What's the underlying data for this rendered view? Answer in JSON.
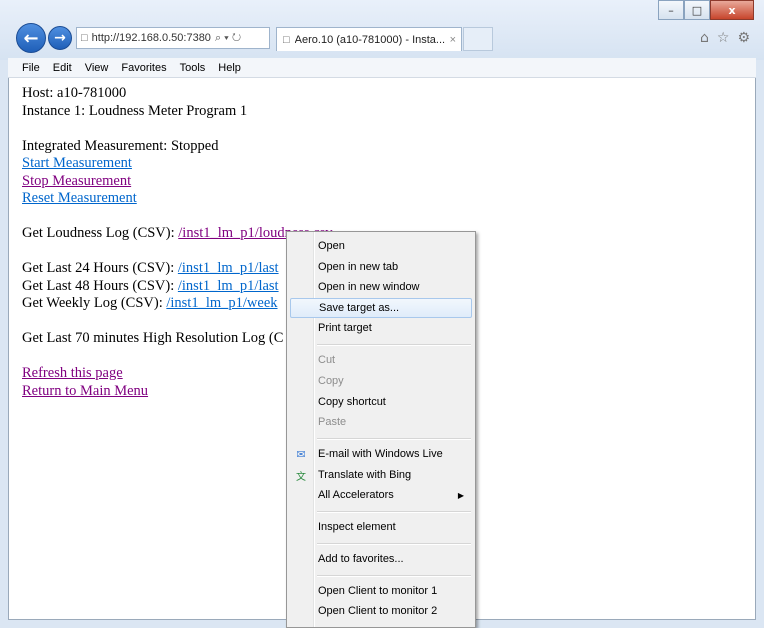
{
  "browser": {
    "address": "http://192.168.0.50:7380",
    "address_controls": "⌕ ▾ ↻",
    "tab_title": "Aero.10 (a10-781000) - Insta...",
    "tab_close": "×",
    "window_buttons": {
      "minimize": "–",
      "maximize": "□",
      "close": "x"
    },
    "icons": {
      "home": "⌂",
      "star": "☆",
      "gear": "⚙"
    }
  },
  "menubar": [
    "File",
    "Edit",
    "View",
    "Favorites",
    "Tools",
    "Help"
  ],
  "page": {
    "host": "Host: a10-781000",
    "instance": "Instance 1: Loudness Meter Program 1",
    "integrated": "Integrated Measurement: Stopped",
    "start": "Start Measurement",
    "stop": "Stop Measurement",
    "reset": "Reset Measurement",
    "loudness_log_label": "Get Loudness Log (CSV): ",
    "loudness_log_link": "/inst1_lm_p1/loudness.csv",
    "last24_label": "Get Last 24 Hours (CSV): ",
    "last24_link": "/inst1_lm_p1/last",
    "last48_label": "Get Last 48 Hours (CSV): ",
    "last48_link": "/inst1_lm_p1/last",
    "weekly_label": "Get Weekly Log (CSV): ",
    "weekly_link": "/inst1_lm_p1/week",
    "hires_label": "Get Last 70 minutes High Resolution Log (C",
    "refresh": "Refresh this page",
    "main_menu": "Return to Main Menu"
  },
  "context_menu": {
    "open": "Open",
    "open_new_tab": "Open in new tab",
    "open_new_window": "Open in new window",
    "save_target": "Save target as...",
    "print_target": "Print target",
    "cut": "Cut",
    "copy": "Copy",
    "copy_shortcut": "Copy shortcut",
    "paste": "Paste",
    "email": "E-mail with Windows Live",
    "translate": "Translate with Bing",
    "accelerators": "All Accelerators",
    "inspect": "Inspect element",
    "favorites": "Add to favorites...",
    "client1": "Open Client to monitor 1",
    "client2": "Open Client to monitor 2"
  }
}
